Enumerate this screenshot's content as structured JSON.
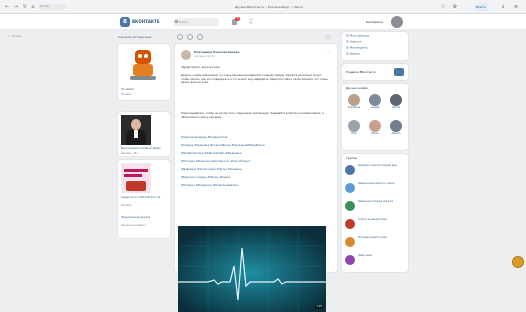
{
  "browser": {
    "address": "vk.com",
    "tab_title": "Друзья ВКонтакте • Екатеринбург • Лента",
    "right_button": "Войти"
  },
  "header": {
    "logo_letter": "В",
    "brand": "ВКОНТАКТЕ",
    "search_placeholder": "Поиск",
    "notify_count": "3",
    "user_name": "Екатерина"
  },
  "sidebar": {
    "link": "← Назад"
  },
  "feed_filter": {
    "label": "Сначала интересные"
  },
  "left_ads": [
    {
      "caption": "Не зевай!",
      "subtitle": "Реклама"
    },
    {
      "caption": "Выступление в прямом эфире",
      "subtitle": "Реклама · 18+"
    },
    {
      "caption": "Кредиты на 1 000 000 ₽ в год",
      "subtitle": "Реклама"
    },
    {
      "caption": "Предложение для вас",
      "subtitle": "Финансы и кредиты"
    }
  ],
  "post": {
    "author": "Екатерина Константинова",
    "date": "сегодня в 12:33",
    "greeting": "Здравствуйте, дорогие мои!",
    "paragraph1": "Делюсь с вами небольшим, но очень важным материалом о нашем сердце. Уделите несколько минут, чтобы понять, как его поддержать и что может ему навредить. Берегите себя и своих близких, это очень важно для нас всех.",
    "paragraph2": "Подписывайтесь, чтобы не пропустить следующие публикации. Задавайте вопросы в комментариях, я обязательно отвечу каждому.",
    "links": [
      "#ЗдоровоеСердце #Кардиология",
      "#Сердце #Здоровье #СоветыВрача #ЗдоровыйОбразЖизни",
      "#Профилактика #ЗаботаОСебе #Медицина",
      "#Питание #ФизическаяАктивность #Сон #Стресс",
      "#Давление #Холестерин #Пульс #Анализы",
      "#Берегите сердце #Жизнь #Семья",
      "#Полезно #Интересно #Подписывайтесь"
    ],
    "video_duration": "1:18"
  },
  "right": {
    "menu": [
      "Моя страница",
      "Новости",
      "Мессенджер",
      "Друзья"
    ],
    "promo": "Подарки ВКонтакте",
    "friends_title": "Друзья онлайн",
    "friends": [
      {
        "name": "Екатерина",
        "color": "#b9a08a"
      },
      {
        "name": "Андрей",
        "color": "#7d8a99"
      },
      {
        "name": "Сергей",
        "color": "#5e6670"
      },
      {
        "name": "Олег",
        "color": "#9aa3ad"
      },
      {
        "name": "Ирина",
        "color": "#c7a18c"
      },
      {
        "name": "Михаил",
        "color": "#6f7d8c"
      }
    ],
    "groups_title": "Группы",
    "groups": [
      {
        "title": "Здоровье и красота каждый день",
        "color": "#4a76a8"
      },
      {
        "title": "Медицинские новости и советы",
        "color": "#5b9bd5"
      },
      {
        "title": "Правильное питание для всех",
        "color": "#3a8f5a"
      },
      {
        "title": "Спорт и активный отдых",
        "color": "#c0392b"
      },
      {
        "title": "Полезные рецепты дома",
        "color": "#d98c2b"
      },
      {
        "title": "Наша семья",
        "color": "#8e44ad"
      }
    ]
  },
  "colors": {
    "accent": "#4a76a8",
    "link": "#2a5885",
    "video_bg": "#0f4b5a",
    "ecg_line": "#e8f6ff"
  }
}
